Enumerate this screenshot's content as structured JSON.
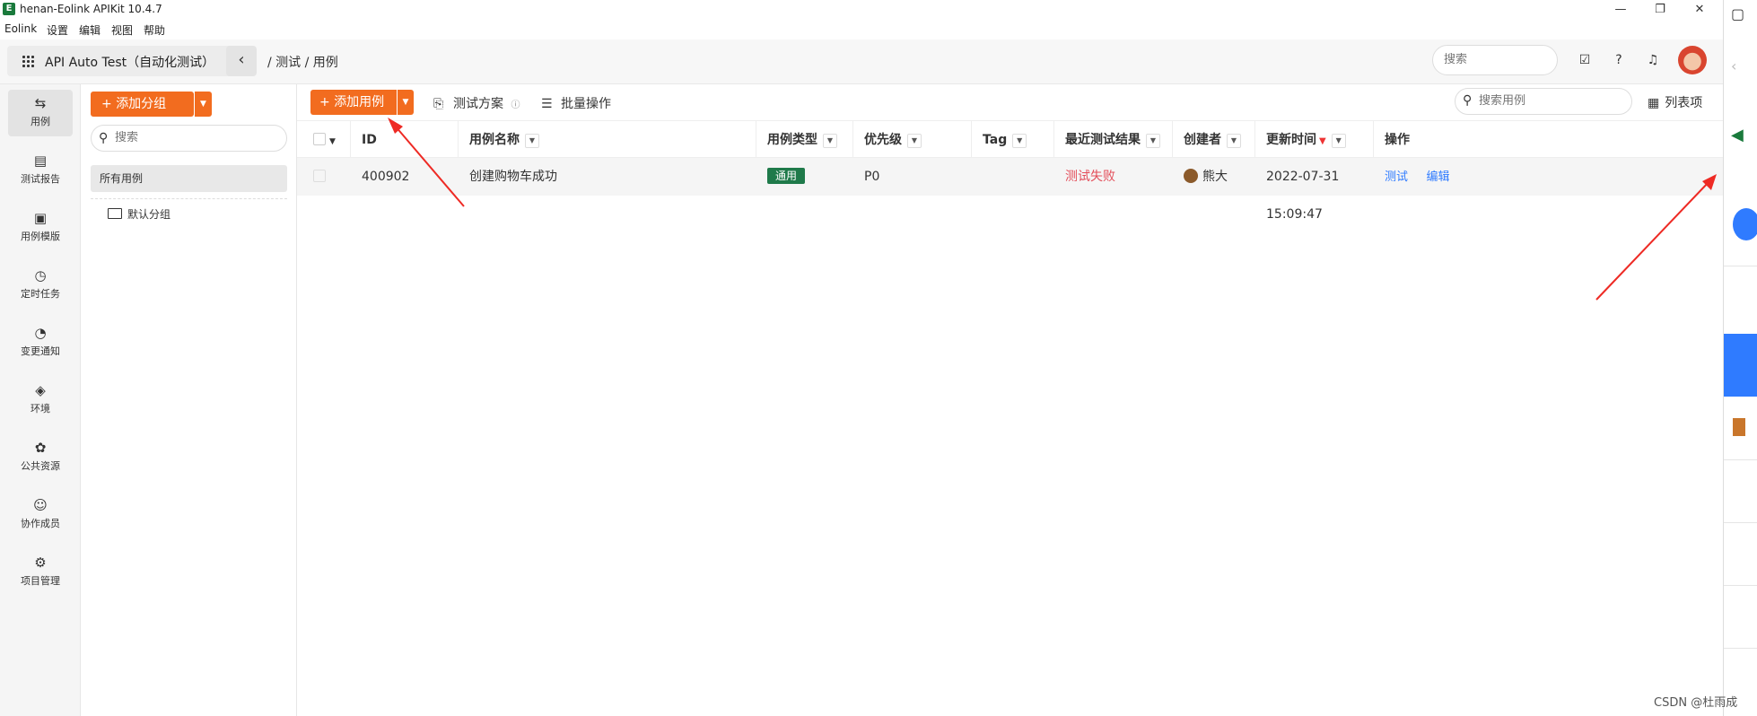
{
  "window": {
    "title": "henan-Eolink APIKit 10.4.7",
    "controls": [
      "—",
      "❐",
      "✕"
    ]
  },
  "menu": [
    "Eolink",
    "设置",
    "编辑",
    "视图",
    "帮助"
  ],
  "topbar": {
    "project": "API Auto Test（自动化测试）",
    "breadcrumb": "/ 测试 / 用例",
    "search_placeholder": "搜索"
  },
  "leftnav": [
    {
      "label": "用例",
      "icon": "swap-icon",
      "glyph": "⇆",
      "active": true
    },
    {
      "label": "测试报告",
      "icon": "report-icon",
      "glyph": "▤"
    },
    {
      "label": "用例模版",
      "icon": "template-icon",
      "glyph": "▣"
    },
    {
      "label": "定时任务",
      "icon": "timer-icon",
      "glyph": "◷"
    },
    {
      "label": "变更通知",
      "icon": "bell-icon",
      "glyph": "◔"
    },
    {
      "label": "环境",
      "icon": "environment-icon",
      "glyph": "◈"
    },
    {
      "label": "公共资源",
      "icon": "puzzle-icon",
      "glyph": "✿"
    },
    {
      "label": "协作成员",
      "icon": "members-icon",
      "glyph": "☺"
    },
    {
      "label": "项目管理",
      "icon": "settings-icon",
      "glyph": "⚙"
    }
  ],
  "groups": {
    "add_label": "添加分组",
    "search_placeholder": "搜索",
    "all_label": "所有用例",
    "default_group": "默认分组"
  },
  "toolbar": {
    "add_case": "添加用例",
    "plan": "测试方案",
    "batch": "批量操作",
    "search_placeholder": "搜索用例",
    "columns": "列表项"
  },
  "table": {
    "headers": {
      "id": "ID",
      "name": "用例名称",
      "type": "用例类型",
      "priority": "优先级",
      "tag": "Tag",
      "result": "最近测试结果",
      "creator": "创建者",
      "updated": "更新时间",
      "actions": "操作"
    },
    "rows": [
      {
        "id": "400902",
        "name": "创建购物车成功",
        "type": "通用",
        "priority": "P0",
        "tag": "",
        "result": "测试失败",
        "creator": "熊大",
        "updated": "2022-07-31 15:09:47",
        "action_test": "测试",
        "action_edit": "编辑"
      }
    ]
  },
  "watermark": "CSDN @杜雨成",
  "colors": {
    "accent": "#f26c1f",
    "link": "#2f7bff",
    "fail": "#e34d59",
    "tag": "#1f7a4a",
    "arrow": "#ee2a24"
  }
}
